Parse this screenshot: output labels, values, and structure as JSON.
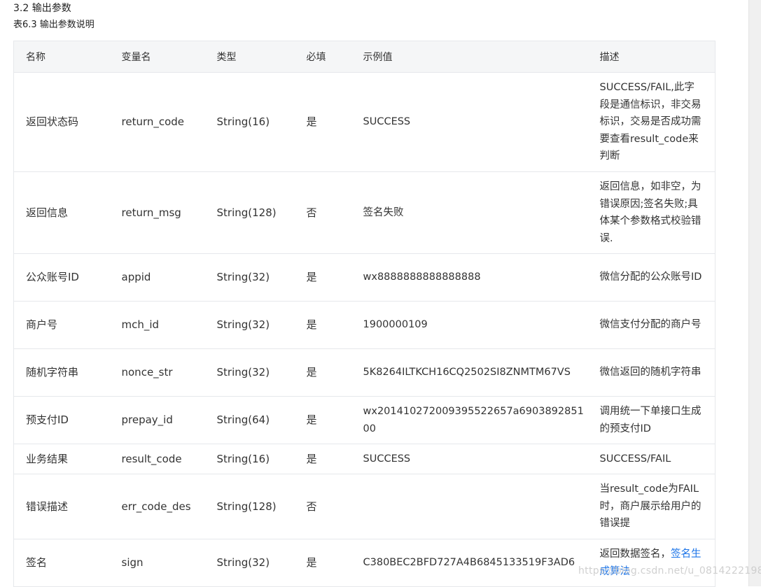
{
  "section": {
    "title": "3.2 输出参数",
    "caption": "表6.3 输出参数说明"
  },
  "headers": [
    "名称",
    "变量名",
    "类型",
    "必填",
    "示例值",
    "描述"
  ],
  "rows": [
    {
      "name": "返回状态码",
      "var": "return_code",
      "type": "String(16)",
      "required": "是",
      "example": "SUCCESS",
      "desc": "SUCCESS/FAIL,此字段是通信标识，非交易标识，交易是否成功需要查看result_code来判断",
      "desc_link": ""
    },
    {
      "name": "返回信息",
      "var": "return_msg",
      "type": "String(128)",
      "required": "否",
      "example": "签名失败",
      "desc": "返回信息，如非空，为错误原因;签名失败;具体某个参数格式校验错误.",
      "desc_link": ""
    },
    {
      "name": "公众账号ID",
      "var": "appid",
      "type": "String(32)",
      "required": "是",
      "example": "wx8888888888888888",
      "desc": "微信分配的公众账号ID",
      "desc_link": ""
    },
    {
      "name": "商户号",
      "var": "mch_id",
      "type": "String(32)",
      "required": "是",
      "example": "1900000109",
      "desc": "微信支付分配的商户号",
      "desc_link": ""
    },
    {
      "name": "随机字符串",
      "var": "nonce_str",
      "type": "String(32)",
      "required": "是",
      "example": "5K8264ILTKCH16CQ2502SI8ZNMTM67VS",
      "desc": "微信返回的随机字符串",
      "desc_link": ""
    },
    {
      "name": "预支付ID",
      "var": "prepay_id",
      "type": "String(64)",
      "required": "是",
      "example": "wx201410272009395522657a690389285100",
      "desc": "调用统一下单接口生成的预支付ID",
      "desc_link": ""
    },
    {
      "name": "业务结果",
      "var": "result_code",
      "type": "String(16)",
      "required": "是",
      "example": "SUCCESS",
      "desc": "SUCCESS/FAIL",
      "desc_link": ""
    },
    {
      "name": "错误描述",
      "var": "err_code_des",
      "type": "String(128)",
      "required": "否",
      "example": "",
      "desc": "当result_code为FAIL时，商户展示给用户的错误提",
      "desc_link": ""
    },
    {
      "name": "签名",
      "var": "sign",
      "type": "String(32)",
      "required": "是",
      "example": "C380BEC2BFD727A4B6845133519F3AD6",
      "desc": "返回数据签名，",
      "desc_link": "签名生成算法"
    }
  ],
  "watermark": "https://blog.csdn.net/u_0814222198",
  "colors": {
    "link": "#1a73e8",
    "header_bg": "#f5f6f7",
    "border": "#e6e8eb"
  }
}
